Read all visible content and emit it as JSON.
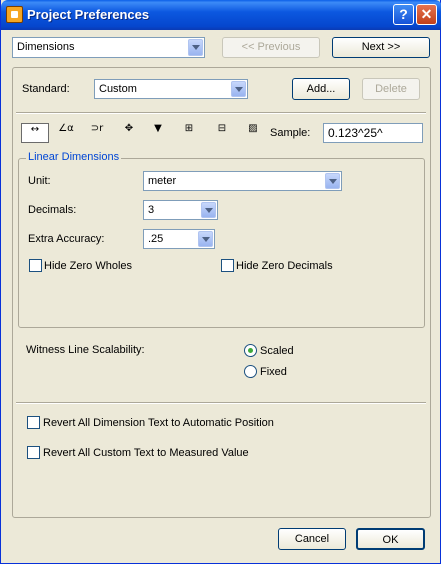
{
  "window": {
    "title": "Project Preferences",
    "help": "?",
    "close": "✕"
  },
  "nav": {
    "page": "Dimensions",
    "previous": "<< Previous",
    "next": "Next >>"
  },
  "standard": {
    "label": "Standard:",
    "value": "Custom",
    "add": "Add...",
    "delete": "Delete"
  },
  "toolbar": {
    "sample_label": "Sample:",
    "sample_value": "0.123^25^"
  },
  "linear": {
    "title": "Linear Dimensions",
    "unit_label": "Unit:",
    "unit_value": "meter",
    "decimals_label": "Decimals:",
    "decimals_value": "3",
    "extra_label": "Extra Accuracy:",
    "extra_value": ".25",
    "hide_wholes": "Hide Zero Wholes",
    "hide_decimals": "Hide Zero Decimals"
  },
  "witness": {
    "label": "Witness Line Scalability:",
    "scaled": "Scaled",
    "fixed": "Fixed"
  },
  "revert": {
    "position": "Revert All Dimension Text to Automatic Position",
    "custom": "Revert All Custom Text to Measured Value"
  },
  "footer": {
    "cancel": "Cancel",
    "ok": "OK"
  }
}
